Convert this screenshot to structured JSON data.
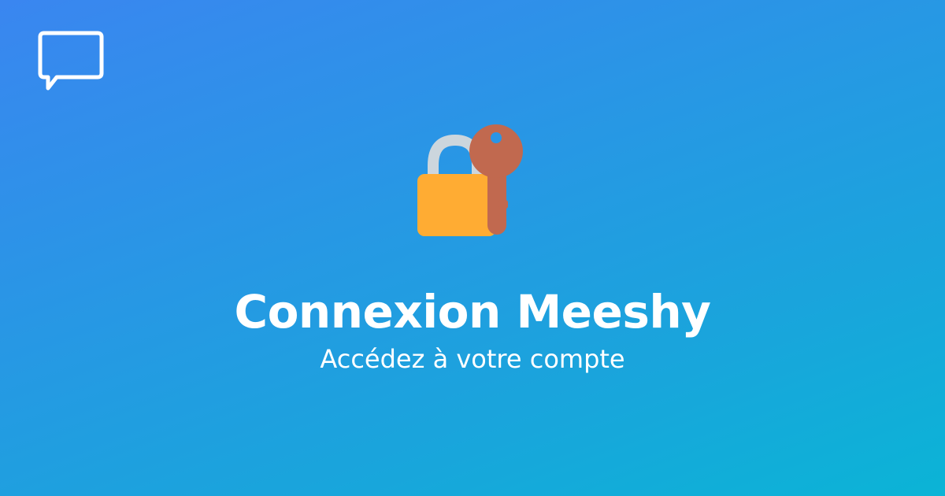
{
  "header": {
    "logo_icon": "chat-bubble-icon"
  },
  "hero": {
    "icon": "lock-with-key-icon",
    "title": "Connexion Meeshy",
    "subtitle": "Accédez à votre compte"
  },
  "colors": {
    "background_start": "#3a86f0",
    "background_end": "#0bb4d6",
    "text": "#ffffff",
    "lock_body": "#ffac33",
    "lock_shackle": "#ccd6dd",
    "key": "#c1694f"
  }
}
